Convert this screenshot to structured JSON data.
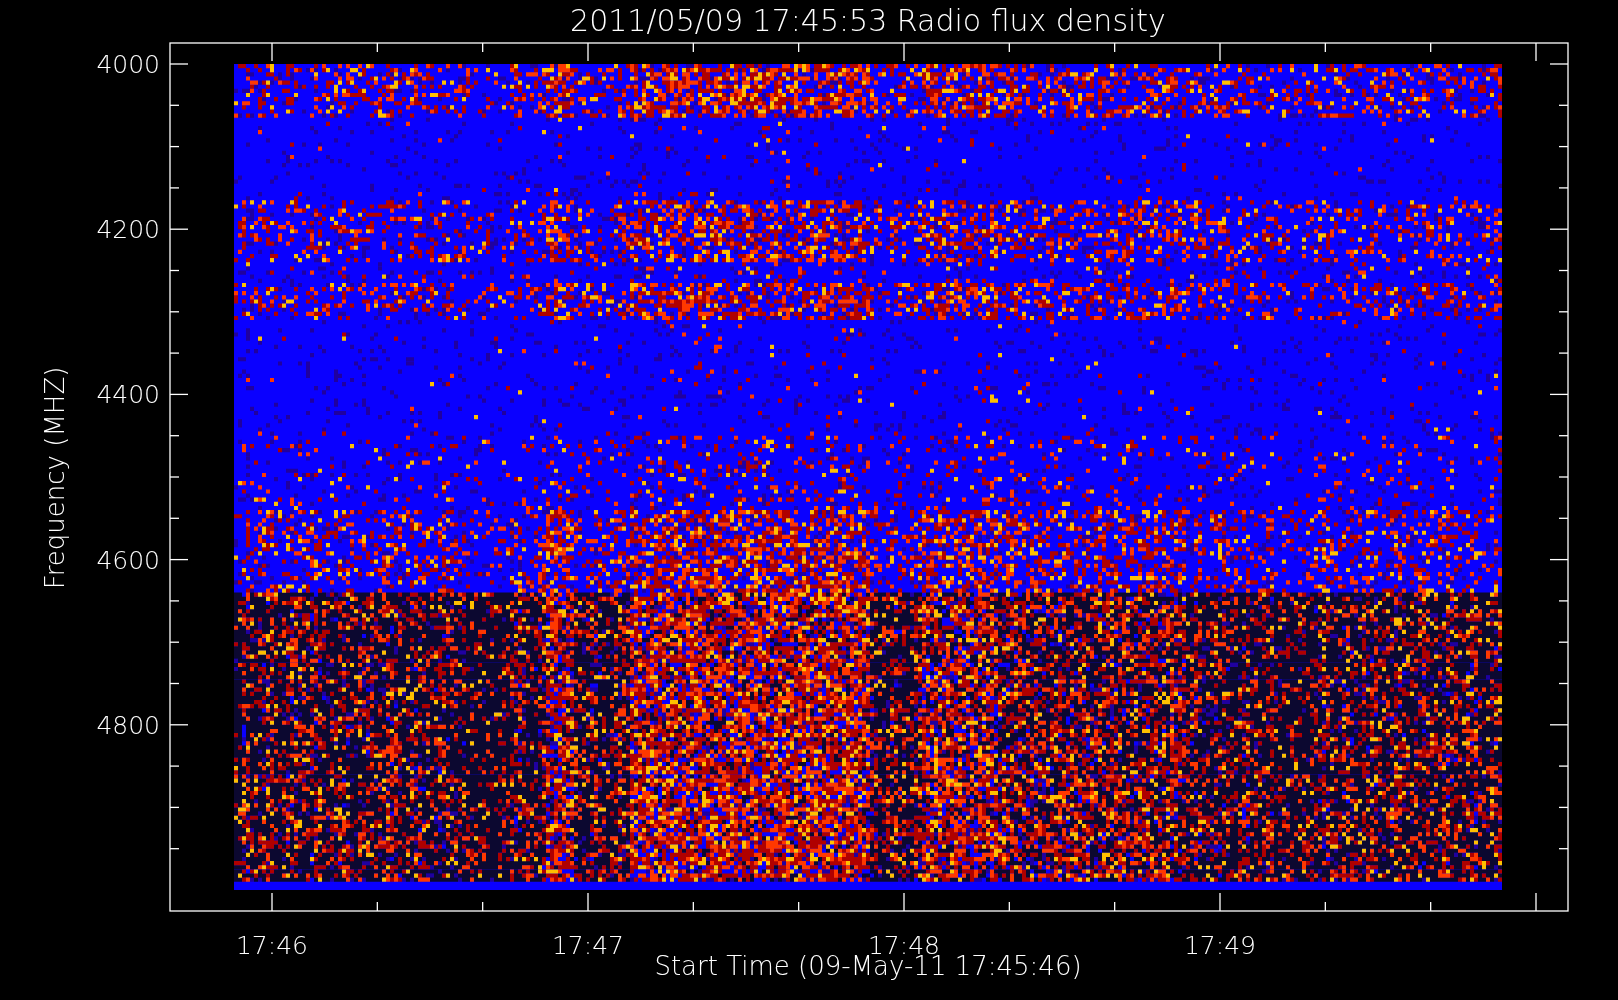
{
  "plot": {
    "title": "2011/05/09 17:45:53 Radio flux density",
    "ylabel": "Frequency (MHZ)",
    "xlabel": "Start Time (09-May-11 17:45:46)",
    "yticks": [
      "4000",
      "4200",
      "4400",
      "4600",
      "4800"
    ],
    "xticks": [
      "17:46",
      "17:47",
      "17:48",
      "17:49"
    ]
  }
}
